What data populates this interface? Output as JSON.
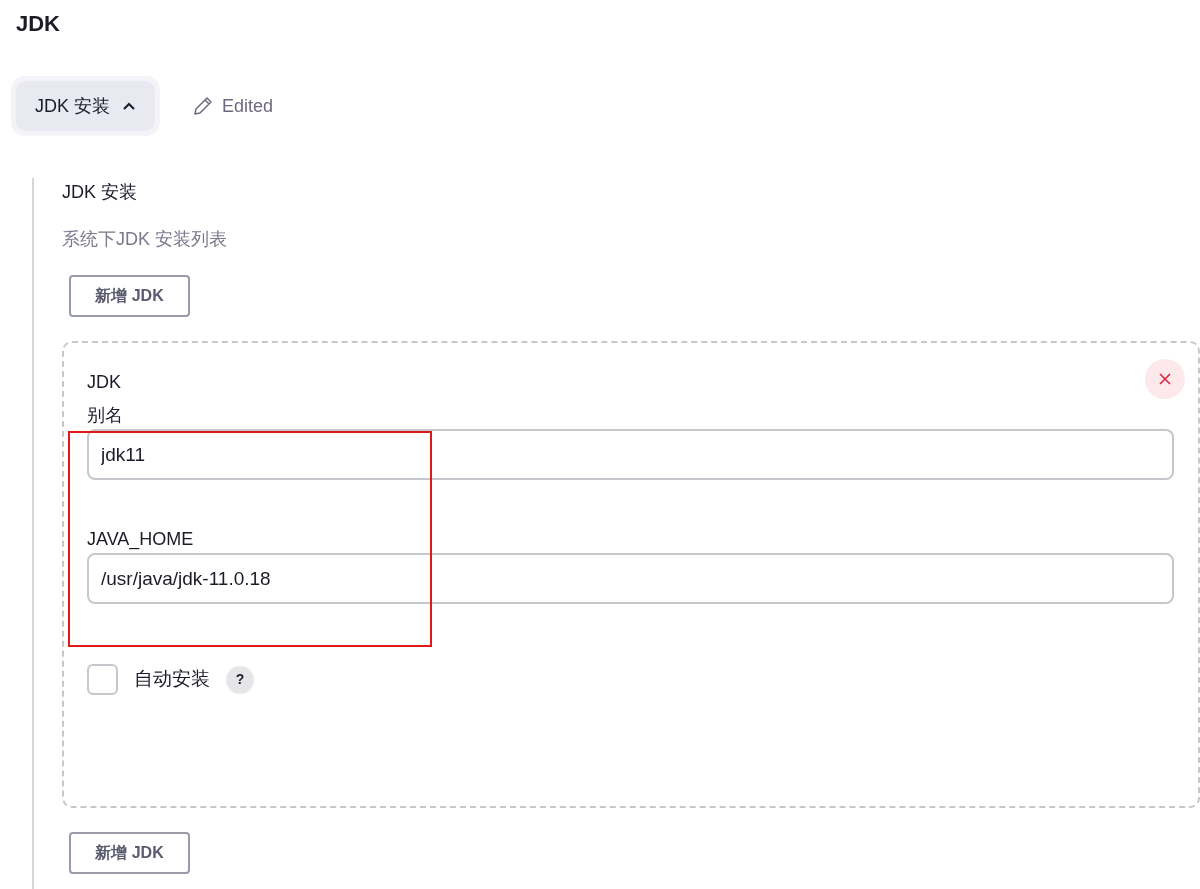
{
  "title": "JDK",
  "section_button": {
    "label": "JDK 安装",
    "expanded": true
  },
  "edited_label": "Edited",
  "section": {
    "label": "JDK 安装",
    "description": "系统下JDK 安装列表"
  },
  "add_buttons": [
    "新增 JDK",
    "新增 JDK"
  ],
  "item": {
    "heading": "JDK",
    "fields": [
      {
        "label": "别名",
        "value": "jdk11"
      },
      {
        "label": "JAVA_HOME",
        "value": "/usr/java/jdk-11.0.18"
      }
    ],
    "auto_install": {
      "label": "自动安装",
      "checked": false,
      "help": "?"
    }
  }
}
